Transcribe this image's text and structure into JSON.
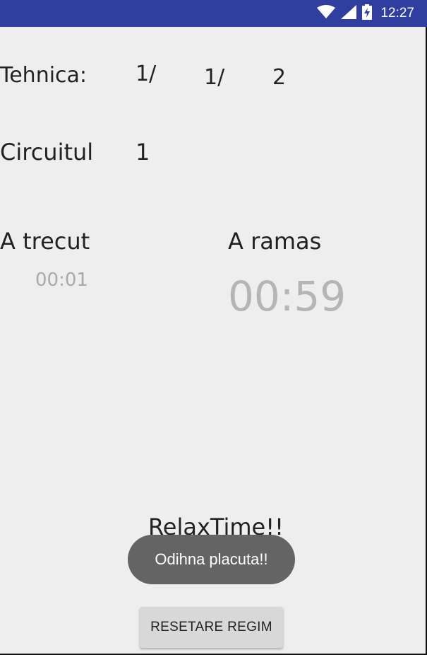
{
  "status_bar": {
    "time": "12:27",
    "icons": [
      "wifi-icon",
      "signal-icon",
      "battery-charging-icon"
    ],
    "bg_color": "#303f9f"
  },
  "tehnica": {
    "label": "Tehnica:",
    "value_1": "1/",
    "value_2": "1/",
    "value_3": "2"
  },
  "circuit": {
    "label": "Circuitul",
    "value": "1"
  },
  "elapsed": {
    "label": "A trecut",
    "time": "00:01"
  },
  "remaining": {
    "label": "A ramas",
    "time": "00:59"
  },
  "relax_label": "RelaxTime!!",
  "toast": {
    "message": "Odihna placuta!!"
  },
  "reset_button": {
    "label": "RESETARE REGIM"
  }
}
